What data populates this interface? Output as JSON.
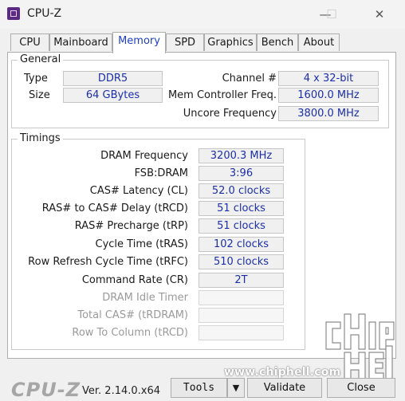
{
  "window": {
    "title": "CPU-Z",
    "minimize": "—",
    "maximize": "☐",
    "close": "✕"
  },
  "tabs": [
    {
      "label": "CPU",
      "active": false
    },
    {
      "label": "Mainboard",
      "active": false
    },
    {
      "label": "Memory",
      "active": true
    },
    {
      "label": "SPD",
      "active": false
    },
    {
      "label": "Graphics",
      "active": false
    },
    {
      "label": "Bench",
      "active": false
    },
    {
      "label": "About",
      "active": false
    }
  ],
  "general": {
    "title": "General",
    "type_label": "Type",
    "type_value": "DDR5",
    "size_label": "Size",
    "size_value": "64 GBytes",
    "channel_label": "Channel #",
    "channel_value": "4 x 32-bit",
    "mc_freq_label": "Mem Controller Freq.",
    "mc_freq_value": "1600.0 MHz",
    "uncore_label": "Uncore Frequency",
    "uncore_value": "3800.0 MHz"
  },
  "timings": {
    "title": "Timings",
    "rows": [
      {
        "label": "DRAM Frequency",
        "value": "3200.3 MHz",
        "enabled": true
      },
      {
        "label": "FSB:DRAM",
        "value": "3:96",
        "enabled": true
      },
      {
        "label": "CAS# Latency (CL)",
        "value": "52.0 clocks",
        "enabled": true
      },
      {
        "label": "RAS# to CAS# Delay (tRCD)",
        "value": "51 clocks",
        "enabled": true
      },
      {
        "label": "RAS# Precharge (tRP)",
        "value": "51 clocks",
        "enabled": true
      },
      {
        "label": "Cycle Time (tRAS)",
        "value": "102 clocks",
        "enabled": true
      },
      {
        "label": "Row Refresh Cycle Time (tRFC)",
        "value": "510 clocks",
        "enabled": true
      },
      {
        "label": "Command Rate (CR)",
        "value": "2T",
        "enabled": true
      },
      {
        "label": "DRAM Idle Timer",
        "value": "",
        "enabled": false
      },
      {
        "label": "Total CAS# (tRDRAM)",
        "value": "",
        "enabled": false
      },
      {
        "label": "Row To Column (tRCD)",
        "value": "",
        "enabled": false
      }
    ]
  },
  "footer": {
    "logo": "CPU-Z",
    "version": "Ver. 2.14.0.x64",
    "tools_label": "Tools",
    "tools_arrow": "▼",
    "validate_label": "Validate",
    "close_label": "Close"
  },
  "watermark": {
    "url": "www.chiphell.com"
  }
}
